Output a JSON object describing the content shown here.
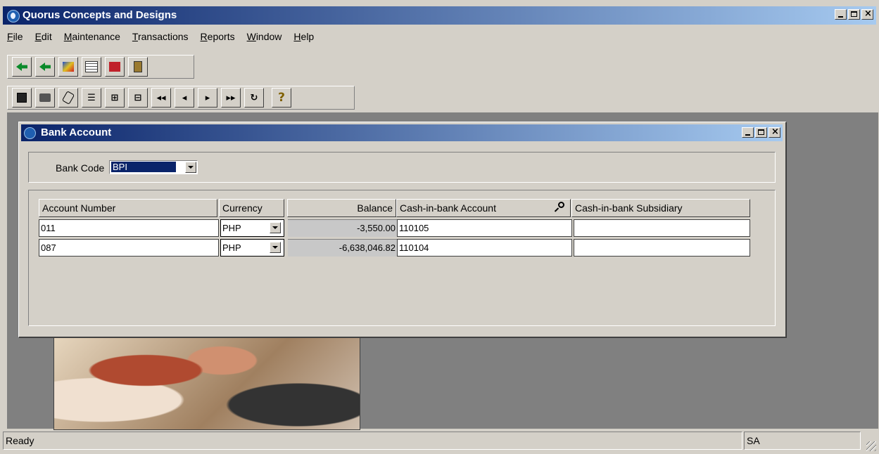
{
  "window": {
    "title": "Quorus Concepts and Designs"
  },
  "menu": [
    {
      "label": "File",
      "key": "F",
      "rest": "ile"
    },
    {
      "label": "Edit",
      "key": "E",
      "rest": "dit"
    },
    {
      "label": "Maintenance",
      "key": "M",
      "rest": "aintenance"
    },
    {
      "label": "Transactions",
      "key": "T",
      "rest": "ransactions"
    },
    {
      "label": "Reports",
      "key": "R",
      "rest": "eports"
    },
    {
      "label": "Window",
      "key": "W",
      "rest": "indow"
    },
    {
      "label": "Help",
      "key": "H",
      "rest": "elp"
    }
  ],
  "toolbar_nav": {
    "first": "◂◂",
    "prev": "◂",
    "next": "▸",
    "last": "▸▸",
    "help": "?"
  },
  "child_window": {
    "title": "Bank Account",
    "bank_code_label": "Bank Code",
    "bank_code_value": "BPI"
  },
  "grid": {
    "columns": [
      "Account Number",
      "Currency",
      "Balance",
      "Cash-in-bank Account",
      "Cash-in-bank Subsidiary"
    ],
    "rows": [
      {
        "account_number": "011",
        "currency": "PHP",
        "balance": "-3,550.00",
        "cash_in_bank_account": "110105",
        "cash_in_bank_subsidiary": ""
      },
      {
        "account_number": "087",
        "currency": "PHP",
        "balance": "-6,638,046.82",
        "cash_in_bank_account": "110104",
        "cash_in_bank_subsidiary": ""
      }
    ]
  },
  "status": {
    "message": "Ready",
    "user": "SA"
  }
}
